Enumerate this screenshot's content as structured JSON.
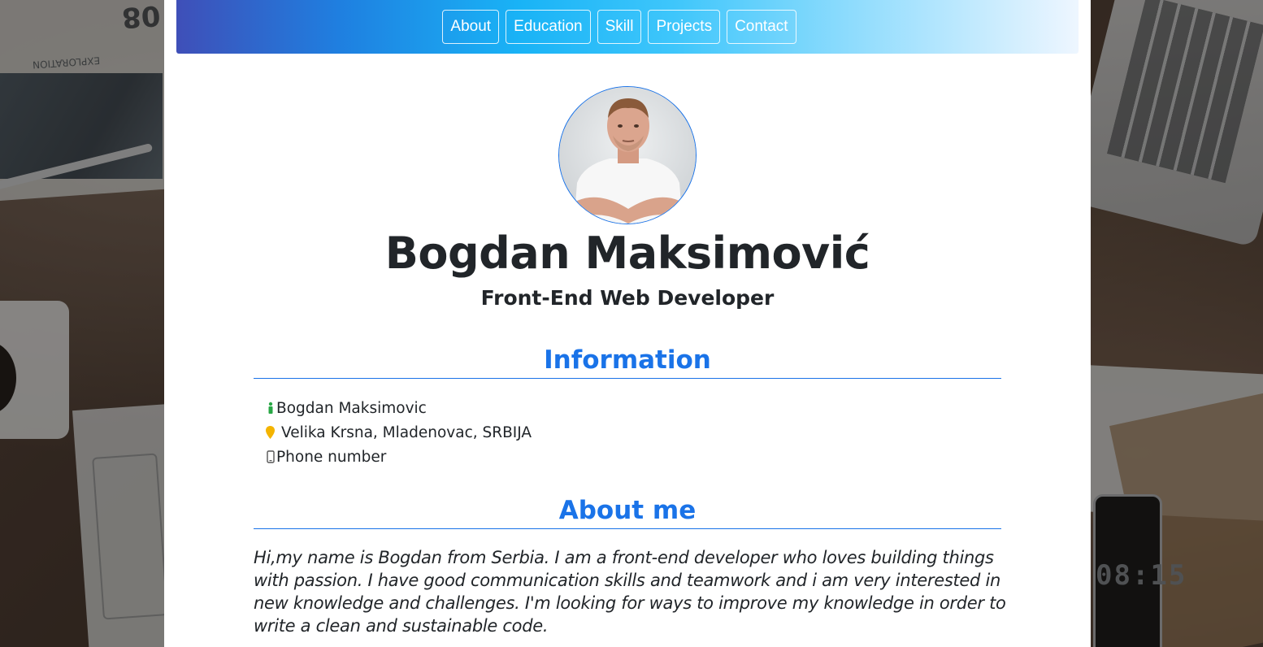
{
  "nav": {
    "items": [
      {
        "label": "About"
      },
      {
        "label": "Education"
      },
      {
        "label": "Skill"
      },
      {
        "label": "Projects"
      },
      {
        "label": "Contact"
      }
    ]
  },
  "profile": {
    "name": "Bogdan Maksimović",
    "role": "Front-End Web Developer"
  },
  "information": {
    "title": "Information",
    "items": [
      {
        "icon": "person-icon",
        "color": "#28a745",
        "text": "Bogdan Maksimovic"
      },
      {
        "icon": "location-pin-icon",
        "color": "#f4b400",
        "text": "Velika Krsna, Mladenovac, SRBIJA"
      },
      {
        "icon": "mobile-phone-icon",
        "color": "#555555",
        "text": "Phone number"
      }
    ]
  },
  "about": {
    "title": "About me",
    "text": "Hi,my name is Bogdan from Serbia. I am a front-end developer who loves building things with passion. I have good communication skills and teamwork and i am very interested in new knowledge and challenges. I'm looking for ways to improve my knowledge in order to write a clean and sustainable code."
  },
  "background": {
    "newspaper_text": "EXPLORATION",
    "newspaper_big": "08",
    "phone_time": "08:15"
  },
  "colors": {
    "accent": "#1a73e8",
    "text": "#212529"
  }
}
